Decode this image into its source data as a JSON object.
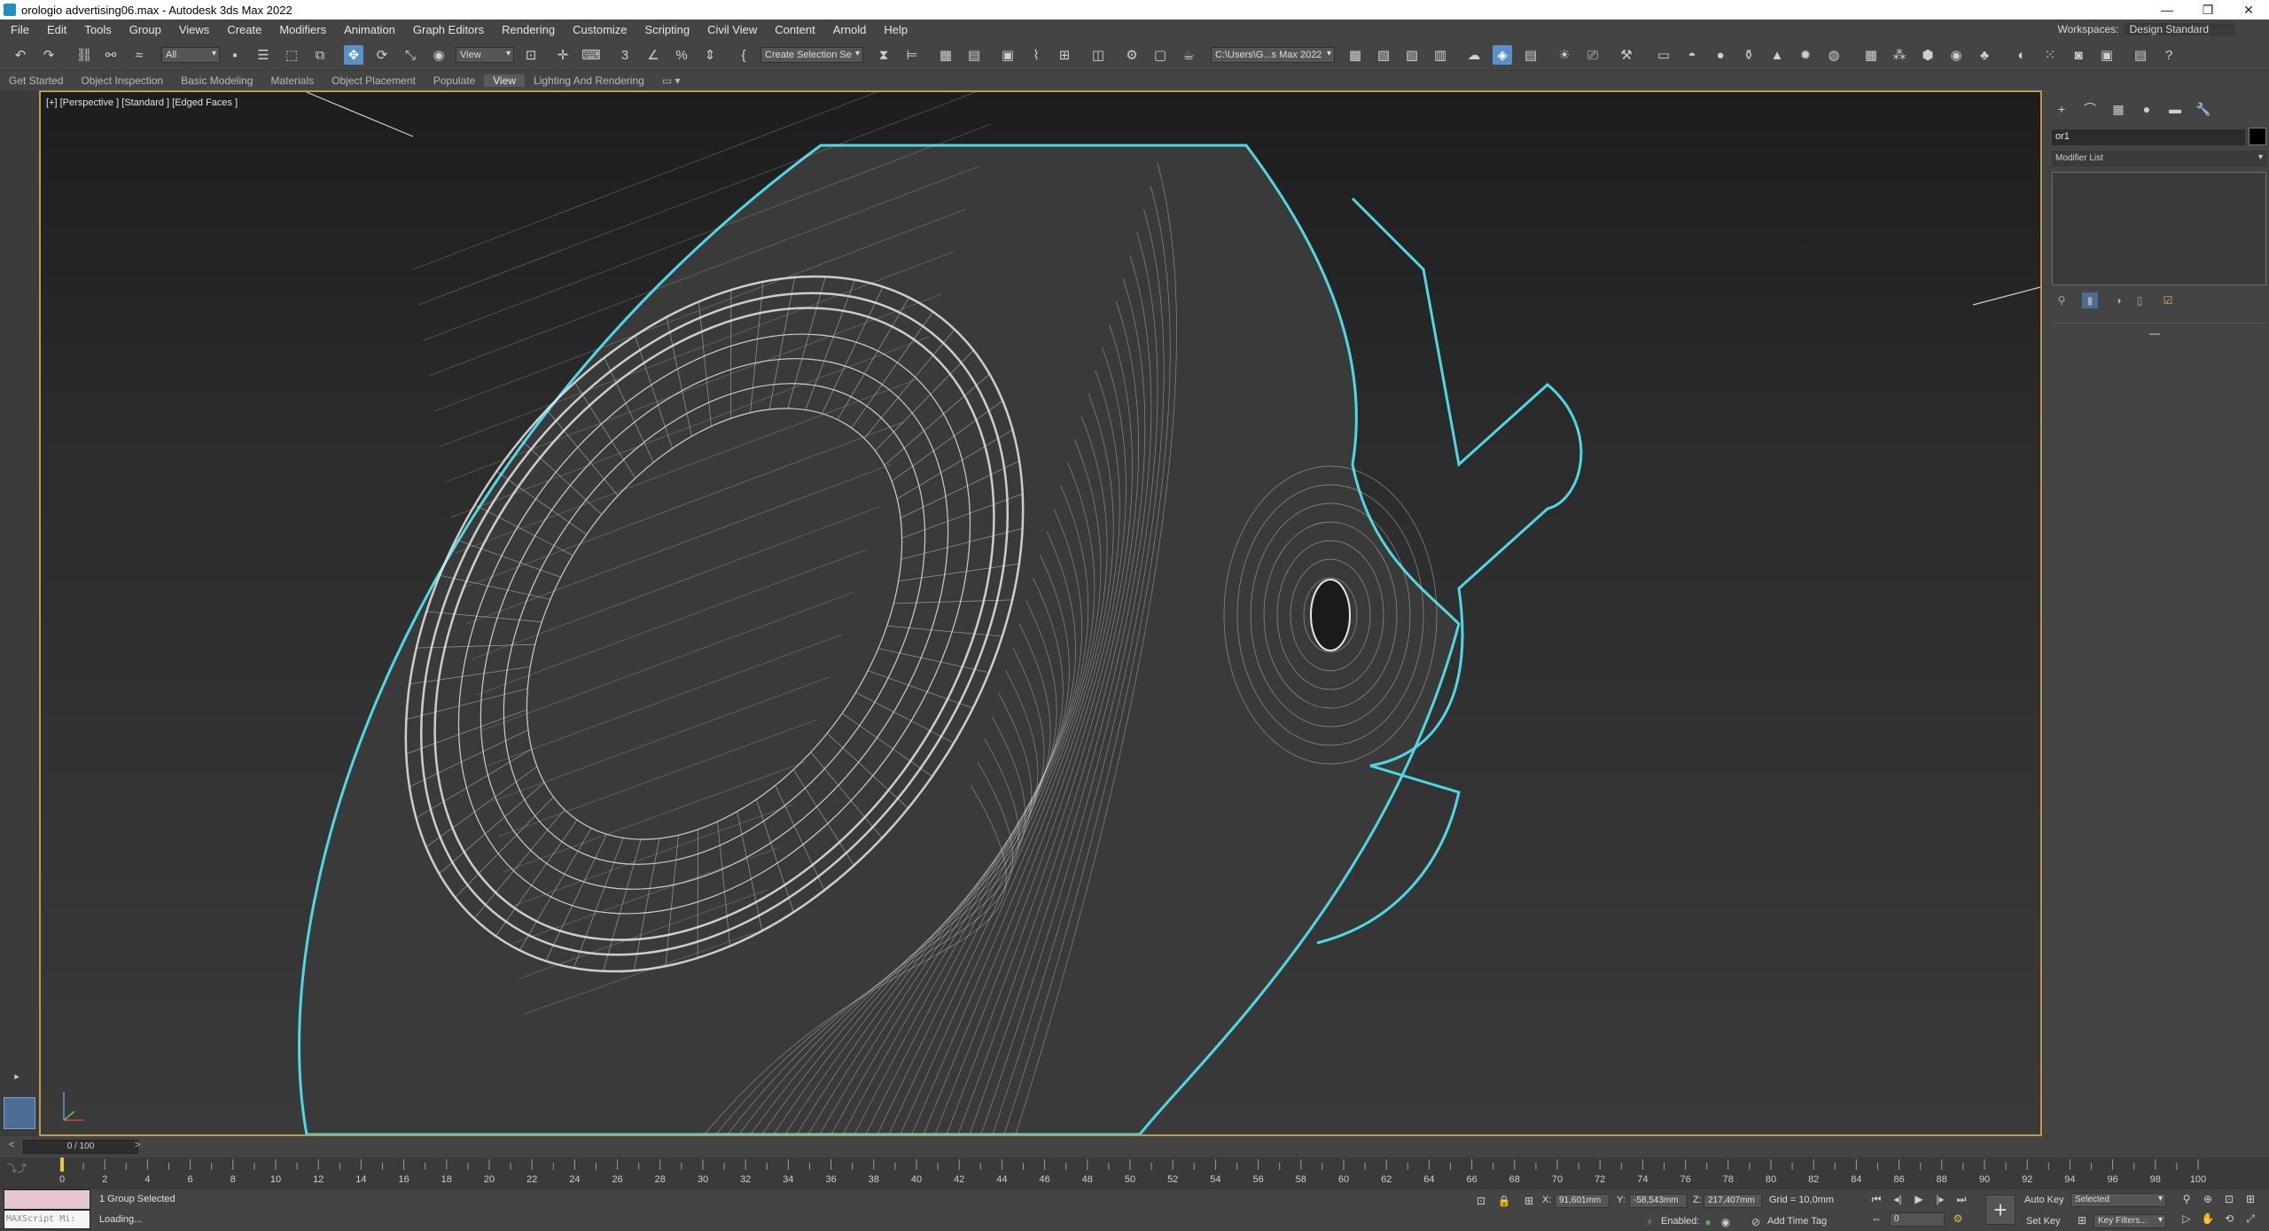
{
  "titlebar": {
    "title": "orologio advertising06.max - Autodesk 3ds Max 2022",
    "minimize_icon": "minimize-icon",
    "maximize_icon": "restore-icon",
    "close_icon": "close-icon"
  },
  "menubar": {
    "items": [
      "File",
      "Edit",
      "Tools",
      "Group",
      "Views",
      "Create",
      "Modifiers",
      "Animation",
      "Graph Editors",
      "Rendering",
      "Customize",
      "Scripting",
      "Civil View",
      "Content",
      "Arnold",
      "Help"
    ],
    "workspace_label": "Workspaces:",
    "workspace_value": "Design Standard"
  },
  "toolbar": {
    "selection_filter": "All",
    "ref_coord": "View",
    "named_selection": "Create Selection Se",
    "project_path": "C:\\Users\\G...s Max 2022"
  },
  "ribbon": {
    "tabs": [
      "Get Started",
      "Object Inspection",
      "Basic Modeling",
      "Materials",
      "Object Placement",
      "Populate",
      "View",
      "Lighting And Rendering"
    ],
    "active_tab": "View"
  },
  "viewport": {
    "label": "[+] [Perspective ] [Standard ] [Edged Faces ]",
    "selection_color": "#4fd7e6",
    "wire_color": "#e8e8e8"
  },
  "command_panel": {
    "object_name": "or1",
    "modifier_list": "Modifier List",
    "object_color": "#000000"
  },
  "timeline": {
    "frame_display": "0 / 100",
    "ticks": [
      "0",
      "2",
      "4",
      "6",
      "8",
      "10",
      "12",
      "14",
      "16",
      "18",
      "20",
      "22",
      "24",
      "26",
      "28",
      "30",
      "32",
      "34",
      "36",
      "38",
      "40",
      "42",
      "44",
      "46",
      "48",
      "50",
      "52",
      "54",
      "56",
      "58",
      "60",
      "62",
      "64",
      "66",
      "68",
      "70",
      "72",
      "74",
      "76",
      "78",
      "80",
      "82",
      "84",
      "86",
      "88",
      "90",
      "92",
      "94",
      "96",
      "98",
      "100"
    ]
  },
  "statusbar": {
    "maxscript_label": "MAXScript Mi:",
    "selection_status": "1 Group Selected",
    "prompt": "Loading...",
    "x_label": "X:",
    "x_value": "91,601mm",
    "y_label": "Y:",
    "y_value": "-58,543mm",
    "z_label": "Z:",
    "z_value": "217,407mm",
    "grid": "Grid = 10,0mm",
    "enabled_label": "Enabled:",
    "add_time_tag": "Add Time Tag",
    "auto_key": "Auto Key",
    "set_key": "Set Key",
    "key_mode": "Selected",
    "key_filters": "Key Filters...",
    "current_frame": "0"
  }
}
